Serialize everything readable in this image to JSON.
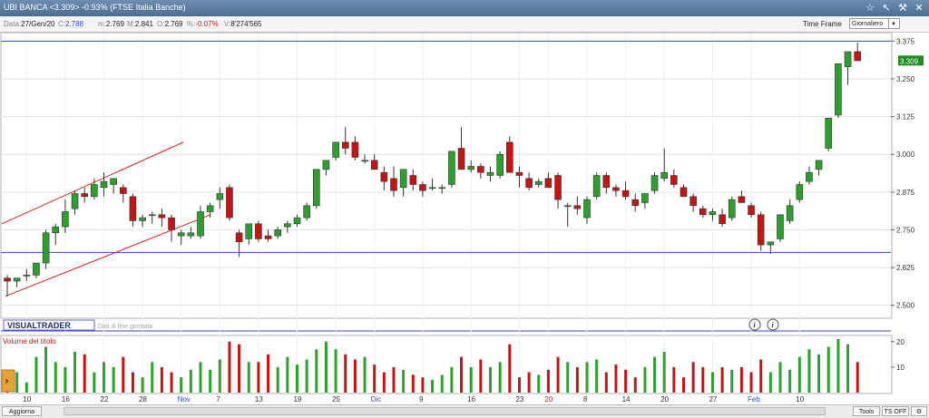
{
  "window": {
    "title": "UBI BANCA <3.309> -0.93%  (FTSE Italia Banche)"
  },
  "info": {
    "data_label": "Data:",
    "data": "27/Gen/20",
    "close_label": "C:",
    "close": "2.788",
    "min_label": "m:",
    "min": "2.769",
    "max_label": "M:",
    "max": "2.841",
    "open_label": "O:",
    "open": "2.769",
    "pct_label": "%:",
    "pct": "-0.07%",
    "vol_label": "V:",
    "vol": "8'274'565"
  },
  "timeframe": {
    "label": "Time Frame",
    "value": "Giornaliero"
  },
  "brand": "VISUALTRADER",
  "watermark": "Dati di fine giornata",
  "volume_title": "Volume del titolo",
  "bottom": {
    "aggiorna": "Aggiorna",
    "tools": "Tools",
    "ts": "TS OFF"
  },
  "colors": {
    "up": "#2e9e2e",
    "down": "#c21515",
    "accent": "#2d4bd1",
    "current_price_bg": "#1e8c1e"
  },
  "chart_data": {
    "type": "candlestick",
    "y_ticks": [
      "3.375",
      "3.250",
      "3.125",
      "3.000",
      "2.875",
      "2.750",
      "2.625",
      "2.500"
    ],
    "ylim": [
      2.46,
      3.4
    ],
    "current_price": "3.309",
    "horizontal_lines": [
      3.375,
      2.675
    ],
    "vol_ticks": [
      "20",
      "10"
    ],
    "vol_max": 21,
    "x_labels": [
      {
        "label": "10",
        "i": 2
      },
      {
        "label": "16",
        "i": 6
      },
      {
        "label": "22",
        "i": 10
      },
      {
        "label": "28",
        "i": 14
      },
      {
        "label": "Nov",
        "i": 18,
        "month": true
      },
      {
        "label": "7",
        "i": 22
      },
      {
        "label": "13",
        "i": 26
      },
      {
        "label": "19",
        "i": 30
      },
      {
        "label": "25",
        "i": 34
      },
      {
        "label": "Dic",
        "i": 38,
        "month": true
      },
      {
        "label": "9",
        "i": 43
      },
      {
        "label": "16",
        "i": 48
      },
      {
        "label": "23",
        "i": 53
      },
      {
        "label": "20",
        "i": 56,
        "month": true,
        "red": true
      },
      {
        "label": "8",
        "i": 60
      },
      {
        "label": "14",
        "i": 64
      },
      {
        "label": "20",
        "i": 68
      },
      {
        "label": "27",
        "i": 73
      },
      {
        "label": "Feb",
        "i": 77,
        "month": true
      },
      {
        "label": "10",
        "i": 82
      }
    ],
    "candles": [
      [
        2.59,
        2.6,
        2.53,
        2.58,
        5
      ],
      [
        2.58,
        2.59,
        2.56,
        2.59,
        8
      ],
      [
        2.6,
        2.62,
        2.58,
        2.6,
        4
      ],
      [
        2.6,
        2.63,
        2.59,
        2.64,
        14
      ],
      [
        2.64,
        2.75,
        2.62,
        2.74,
        18
      ],
      [
        2.74,
        2.77,
        2.7,
        2.76,
        12
      ],
      [
        2.76,
        2.85,
        2.74,
        2.81,
        10
      ],
      [
        2.82,
        2.88,
        2.8,
        2.87,
        16
      ],
      [
        2.87,
        2.89,
        2.84,
        2.86,
        15
      ],
      [
        2.86,
        2.92,
        2.85,
        2.9,
        8
      ],
      [
        2.89,
        2.94,
        2.86,
        2.91,
        12
      ],
      [
        2.9,
        2.92,
        2.87,
        2.92,
        10
      ],
      [
        2.89,
        2.9,
        2.84,
        2.87,
        14
      ],
      [
        2.86,
        2.87,
        2.76,
        2.78,
        8
      ],
      [
        2.78,
        2.8,
        2.76,
        2.79,
        6
      ],
      [
        2.8,
        2.81,
        2.77,
        2.8,
        12
      ],
      [
        2.8,
        2.82,
        2.76,
        2.79,
        10
      ],
      [
        2.79,
        2.8,
        2.71,
        2.75,
        8
      ],
      [
        2.73,
        2.75,
        2.7,
        2.74,
        6
      ],
      [
        2.73,
        2.76,
        2.72,
        2.74,
        9
      ],
      [
        2.73,
        2.83,
        2.72,
        2.81,
        12
      ],
      [
        2.81,
        2.84,
        2.79,
        2.83,
        9
      ],
      [
        2.85,
        2.89,
        2.82,
        2.87,
        13
      ],
      [
        2.89,
        2.9,
        2.78,
        2.79,
        20
      ],
      [
        2.74,
        2.75,
        2.66,
        2.71,
        19
      ],
      [
        2.72,
        2.77,
        2.7,
        2.77,
        12
      ],
      [
        2.77,
        2.78,
        2.71,
        2.72,
        12
      ],
      [
        2.73,
        2.75,
        2.71,
        2.72,
        15
      ],
      [
        2.73,
        2.76,
        2.72,
        2.75,
        10
      ],
      [
        2.76,
        2.78,
        2.74,
        2.77,
        14
      ],
      [
        2.77,
        2.8,
        2.76,
        2.79,
        11
      ],
      [
        2.79,
        2.84,
        2.78,
        2.83,
        13
      ],
      [
        2.83,
        2.95,
        2.82,
        2.95,
        17
      ],
      [
        2.95,
        2.98,
        2.93,
        2.98,
        20
      ],
      [
        2.99,
        3.04,
        2.98,
        3.04,
        17
      ],
      [
        3.04,
        3.09,
        3.0,
        3.02,
        15
      ],
      [
        3.04,
        3.06,
        2.98,
        2.99,
        13
      ],
      [
        2.98,
        3.0,
        2.97,
        2.98,
        14
      ],
      [
        2.98,
        3.0,
        2.95,
        2.95,
        11
      ],
      [
        2.94,
        2.96,
        2.88,
        2.91,
        8
      ],
      [
        2.92,
        2.96,
        2.86,
        2.88,
        10
      ],
      [
        2.89,
        2.95,
        2.86,
        2.95,
        9
      ],
      [
        2.93,
        2.95,
        2.88,
        2.9,
        7
      ],
      [
        2.9,
        2.91,
        2.86,
        2.88,
        6
      ],
      [
        2.89,
        2.92,
        2.88,
        2.89,
        5
      ],
      [
        2.89,
        2.9,
        2.87,
        2.89,
        7
      ],
      [
        2.9,
        3.01,
        2.89,
        3.01,
        10
      ],
      [
        3.02,
        3.09,
        3.0,
        2.95,
        14
      ],
      [
        2.95,
        2.98,
        2.94,
        2.96,
        10
      ],
      [
        2.96,
        2.97,
        2.92,
        2.94,
        13
      ],
      [
        2.93,
        2.96,
        2.91,
        2.94,
        10
      ],
      [
        2.93,
        3.01,
        2.92,
        3.0,
        12
      ],
      [
        3.04,
        3.06,
        2.94,
        2.94,
        19
      ],
      [
        2.94,
        2.96,
        2.89,
        2.93,
        6
      ],
      [
        2.92,
        2.94,
        2.88,
        2.89,
        8
      ],
      [
        2.9,
        2.92,
        2.89,
        2.91,
        7
      ],
      [
        2.92,
        2.94,
        2.9,
        2.89,
        9
      ],
      [
        2.93,
        2.94,
        2.82,
        2.85,
        14
      ],
      [
        2.83,
        2.84,
        2.76,
        2.83,
        12
      ],
      [
        2.83,
        2.86,
        2.8,
        2.82,
        10
      ],
      [
        2.79,
        2.86,
        2.77,
        2.85,
        12
      ],
      [
        2.86,
        2.94,
        2.85,
        2.93,
        13
      ],
      [
        2.93,
        2.94,
        2.87,
        2.89,
        8
      ],
      [
        2.89,
        2.9,
        2.86,
        2.88,
        11
      ],
      [
        2.88,
        2.91,
        2.85,
        2.86,
        9
      ],
      [
        2.85,
        2.87,
        2.81,
        2.83,
        6
      ],
      [
        2.84,
        2.86,
        2.82,
        2.87,
        10
      ],
      [
        2.88,
        2.94,
        2.87,
        2.93,
        14
      ],
      [
        2.92,
        3.02,
        2.91,
        2.94,
        16
      ],
      [
        2.93,
        2.95,
        2.89,
        2.9,
        10
      ],
      [
        2.89,
        2.9,
        2.86,
        2.86,
        6
      ],
      [
        2.86,
        2.87,
        2.81,
        2.83,
        12
      ],
      [
        2.82,
        2.83,
        2.79,
        2.8,
        10
      ],
      [
        2.8,
        2.82,
        2.78,
        2.81,
        8
      ],
      [
        2.8,
        2.82,
        2.76,
        2.77,
        10
      ],
      [
        2.79,
        2.86,
        2.78,
        2.85,
        9
      ],
      [
        2.86,
        2.88,
        2.84,
        2.84,
        10
      ],
      [
        2.83,
        2.84,
        2.79,
        2.8,
        8
      ],
      [
        2.8,
        2.81,
        2.68,
        2.7,
        13
      ],
      [
        2.7,
        2.71,
        2.67,
        2.71,
        8
      ],
      [
        2.72,
        2.8,
        2.71,
        2.8,
        12
      ],
      [
        2.78,
        2.85,
        2.77,
        2.83,
        9
      ],
      [
        2.85,
        2.91,
        2.84,
        2.9,
        14
      ],
      [
        2.91,
        2.96,
        2.9,
        2.94,
        17
      ],
      [
        2.95,
        2.98,
        2.93,
        2.98,
        15
      ],
      [
        3.02,
        3.12,
        3.01,
        3.12,
        18
      ],
      [
        3.13,
        3.3,
        3.12,
        3.3,
        21
      ],
      [
        3.29,
        3.34,
        3.23,
        3.34,
        19
      ],
      [
        3.34,
        3.37,
        3.31,
        3.31,
        12
      ]
    ],
    "trendlines": [
      {
        "x1": 2,
        "y1": 2.77,
        "x2": 202,
        "y2": 3.04
      },
      {
        "x1": 6,
        "y1": 2.53,
        "x2": 232,
        "y2": 2.8
      }
    ]
  }
}
